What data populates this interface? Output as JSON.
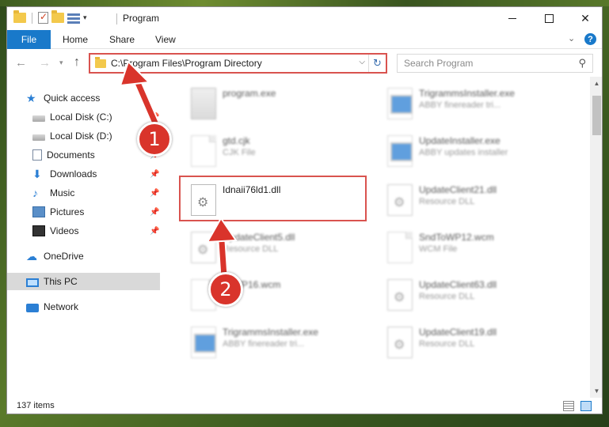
{
  "window": {
    "title": "Program"
  },
  "ribbon": {
    "file": "File",
    "home": "Home",
    "share": "Share",
    "view": "View",
    "help": "?"
  },
  "navigation": {
    "address": "C:\\Program Files\\Program Directory",
    "search_placeholder": "Search Program"
  },
  "sidebar": {
    "items": [
      {
        "label": "Quick access",
        "icon": "star-icon"
      },
      {
        "label": "Local Disk (C:)",
        "icon": "drive-icon",
        "pinned": true
      },
      {
        "label": "Local Disk (D:)",
        "icon": "drive-icon",
        "pinned": true
      },
      {
        "label": "Documents",
        "icon": "documents-icon",
        "pinned": true
      },
      {
        "label": "Downloads",
        "icon": "download-icon",
        "pinned": true
      },
      {
        "label": "Music",
        "icon": "music-icon",
        "pinned": true
      },
      {
        "label": "Pictures",
        "icon": "pictures-icon",
        "pinned": true
      },
      {
        "label": "Videos",
        "icon": "videos-icon",
        "pinned": true
      },
      {
        "label": "OneDrive",
        "icon": "cloud-icon"
      },
      {
        "label": "This PC",
        "icon": "computer-icon",
        "selected": true
      },
      {
        "label": "Network",
        "icon": "network-icon"
      }
    ]
  },
  "files": [
    {
      "name": "program.exe",
      "type": ""
    },
    {
      "name": "gtd.cjk",
      "type": "CJK File"
    },
    {
      "name": "Idnaii76ld1.dll",
      "type": ""
    },
    {
      "name": "UpdateClient5.dll",
      "type": "Resource DLL"
    },
    {
      "name": "ToWP16.wcm",
      "type": "File"
    },
    {
      "name": "TrigrammsInstaller.exe",
      "type": "ABBY finereader tri..."
    },
    {
      "name": "TrigrammsInstaller.exe",
      "type": "ABBY finereader tri..."
    },
    {
      "name": "UpdateInstaller.exe",
      "type": "ABBY updates installer"
    },
    {
      "name": "UpdateClient21.dll",
      "type": "Resource DLL"
    },
    {
      "name": "SndToWP12.wcm",
      "type": "WCM File"
    },
    {
      "name": "UpdateClient63.dll",
      "type": "Resource DLL"
    },
    {
      "name": "UpdateClient19.dll",
      "type": "Resource DLL"
    }
  ],
  "status": {
    "count": "137 items"
  },
  "annotations": {
    "step1": "1",
    "step2": "2"
  },
  "colors": {
    "accent": "#1979ca",
    "highlight": "#d9534f",
    "badge": "#d9342b"
  }
}
